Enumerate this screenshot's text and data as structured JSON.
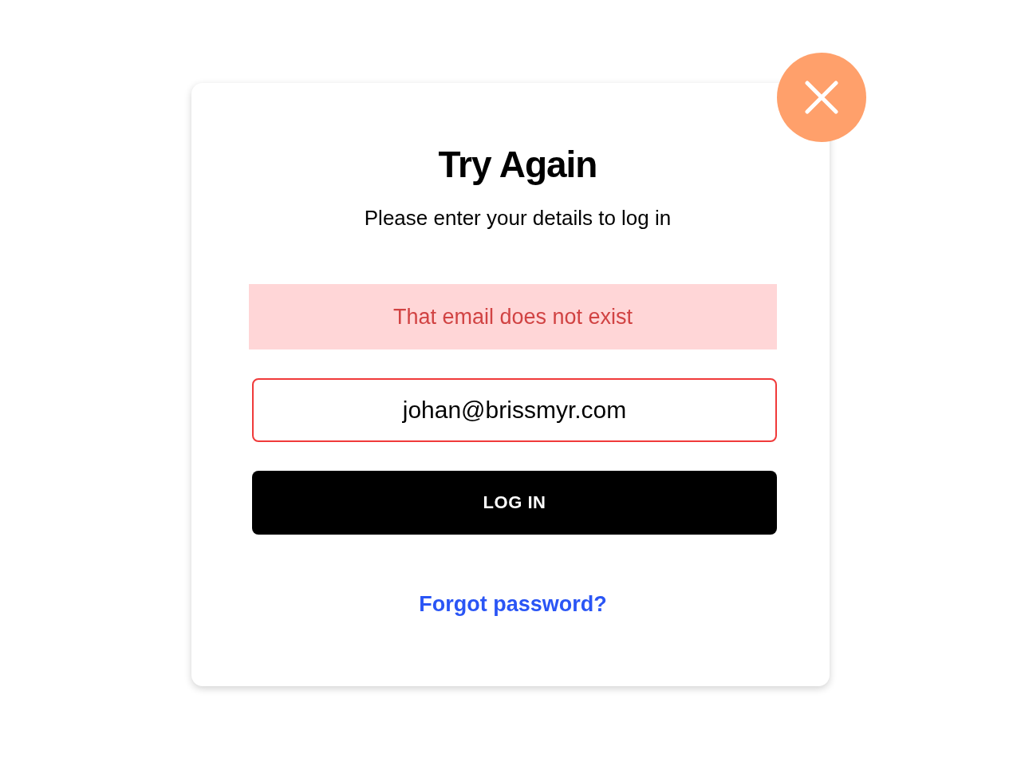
{
  "dialog": {
    "title": "Try Again",
    "subtitle": "Please enter your details to log in",
    "error_message": "That email does not exist",
    "email_field": {
      "value": "johan@brissmyr.com",
      "error": true
    },
    "login_button": "LOG IN",
    "forgot_link": "Forgot password?"
  }
}
